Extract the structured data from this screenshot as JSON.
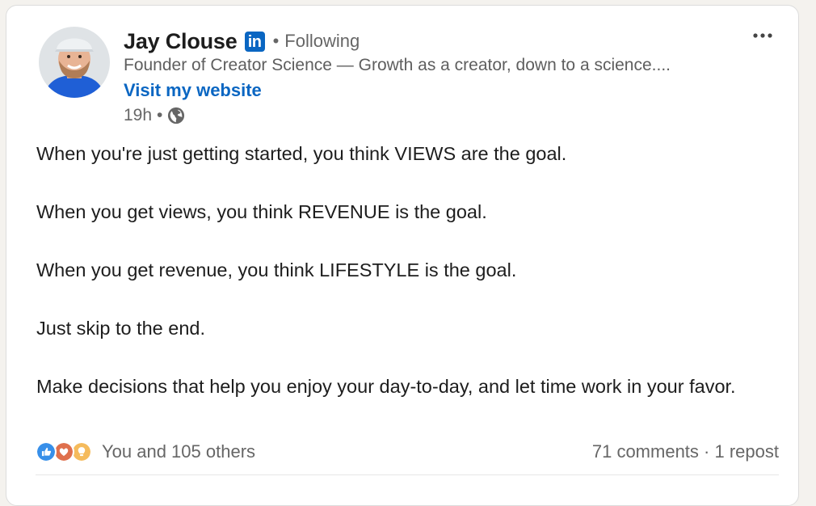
{
  "author": {
    "name": "Jay Clouse",
    "badge": "in",
    "follow_status": "Following",
    "headline": "Founder of Creator Science — Growth as a creator, down to a science....",
    "website_link": "Visit my website"
  },
  "post_meta": {
    "time": "19h",
    "separator": "•",
    "visibility_icon": "globe-icon"
  },
  "post": {
    "paragraphs": [
      "When you're just getting started, you think VIEWS are the goal.",
      "When you get views, you think REVENUE is the goal.",
      "When you get revenue, you think LIFESTYLE is the goal.",
      "Just skip to the end.",
      "Make decisions that help you enjoy your day-to-day, and let time work in your favor."
    ]
  },
  "social": {
    "reaction_icons": [
      "like-icon",
      "love-icon",
      "insightful-icon"
    ],
    "reactions_text": "You and 105 others",
    "comments_text": "71 comments",
    "middot": "·",
    "reposts_text": "1 repost"
  },
  "menu": {
    "icon": "more-options-icon"
  },
  "colors": {
    "brand": "#0a66c2",
    "like": "#378fe9",
    "love": "#df704d",
    "insightful": "#f5bb5c",
    "muted_text": "#666666",
    "primary_text": "#1d1d1d"
  }
}
